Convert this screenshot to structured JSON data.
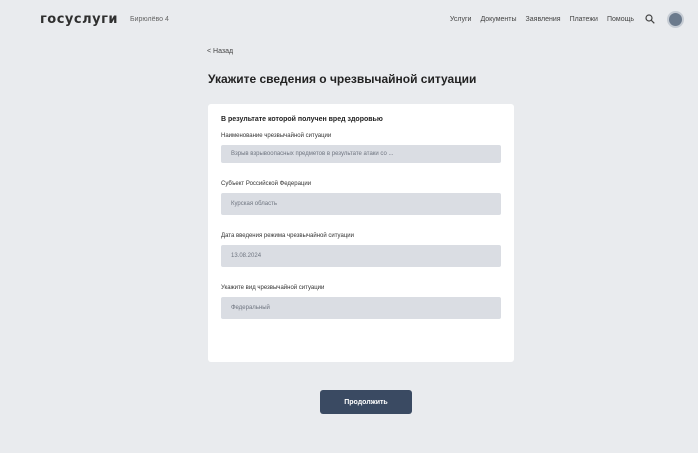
{
  "header": {
    "logo": "госуслуги",
    "region": "Бирюлёво 4",
    "nav": [
      "Услуги",
      "Документы",
      "Заявления",
      "Платежи",
      "Помощь"
    ],
    "search_icon": "search-icon",
    "avatar_icon": "user-avatar"
  },
  "back_link": "< Назад",
  "page_title": "Укажите сведения о чрезвычайной ситуации",
  "form": {
    "heading": "В результате которой получен вред здоровью",
    "fields": [
      {
        "label": "Наименование чрезвычайной ситуации",
        "value": "Взрыв взрывоопасных предметов в результате атаки со ..."
      },
      {
        "label": "Субъект Российской Федерации",
        "value": "Курская область"
      },
      {
        "label": "Дата введения режима чрезвычайной ситуации",
        "value": "13.08.2024"
      },
      {
        "label": "Укажите вид чрезвычайной ситуации",
        "value": "Федеральный"
      }
    ]
  },
  "continue_label": "Продолжить"
}
